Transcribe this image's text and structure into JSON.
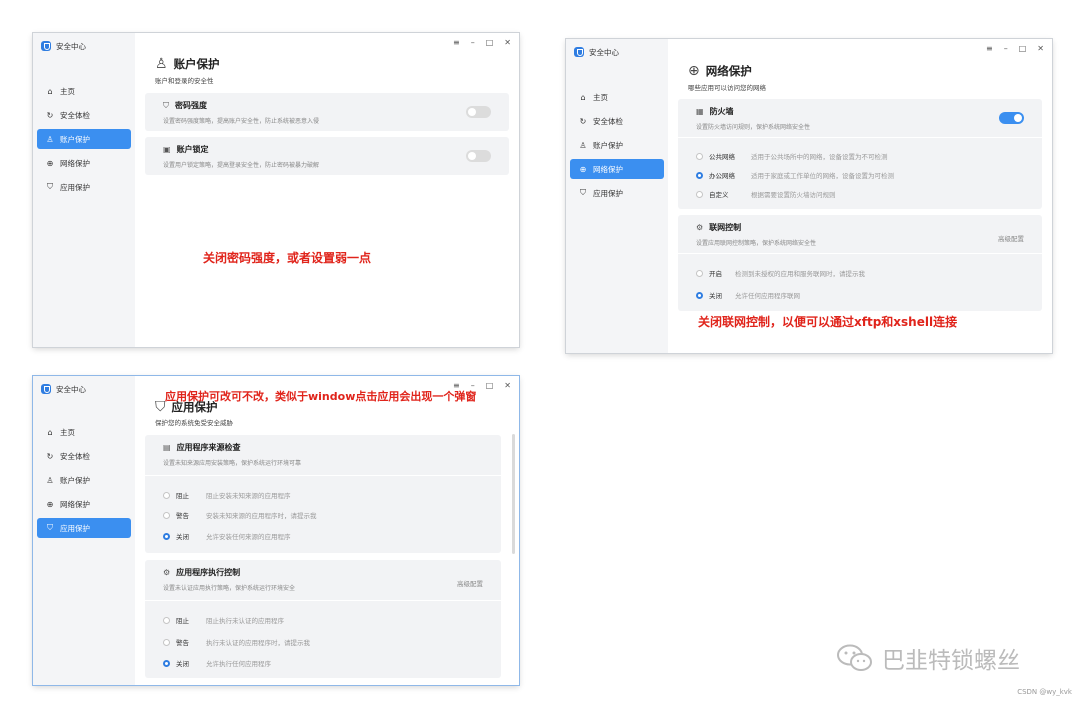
{
  "app_title": "安全中心",
  "nav": [
    "主页",
    "安全体检",
    "账户保护",
    "网络保护",
    "应用保护"
  ],
  "win1": {
    "title": "账户保护",
    "subtitle": "账户和登录的安全性",
    "cards": [
      {
        "title": "密码强度",
        "desc": "设置密码强度策略，提高账户安全性，防止系统被恶意入侵",
        "toggle": false
      },
      {
        "title": "账户锁定",
        "desc": "设置用户锁定策略，提高登录安全性，防止密码被暴力破解",
        "toggle": false
      }
    ],
    "note": "关闭密码强度，或者设置弱一点"
  },
  "win2": {
    "title": "网络保护",
    "subtitle": "哪些应用可以访问您的网络",
    "firewall": {
      "title": "防火墙",
      "desc": "设置防火墙访问规则，保护系统网络安全性",
      "toggle": true,
      "options": [
        {
          "label": "公共网络",
          "desc": "适用于公共场所中的网络，设备设置为不可检测",
          "selected": false
        },
        {
          "label": "办公网络",
          "desc": "适用于家庭或工作单位的网络，设备设置为可检测",
          "selected": true
        },
        {
          "label": "自定义",
          "desc": "根据需要设置防火墙访问规则",
          "selected": false
        }
      ]
    },
    "netctrl": {
      "title": "联网控制",
      "desc": "设置应用联网控制策略，保护系统网络安全性",
      "extra": "高级配置",
      "options": [
        {
          "label": "开启",
          "desc": "检测到未授权的应用和服务联网时，请提示我",
          "selected": false
        },
        {
          "label": "关闭",
          "desc": "允许任何应用程序联网",
          "selected": true
        }
      ]
    },
    "note": "关闭联网控制，以便可以通过xftp和xshell连接"
  },
  "win3": {
    "title": "应用保护",
    "subtitle": "保护您的系统免受安全威胁",
    "source": {
      "title": "应用程序来源检查",
      "desc": "设置未知来源应用安装策略，保护系统运行环境可靠",
      "options": [
        {
          "label": "阻止",
          "desc": "阻止安装未知来源的应用程序",
          "selected": false
        },
        {
          "label": "警告",
          "desc": "安装未知来源的应用程序时，请提示我",
          "selected": false
        },
        {
          "label": "关闭",
          "desc": "允许安装任何来源的应用程序",
          "selected": true
        }
      ]
    },
    "exec": {
      "title": "应用程序执行控制",
      "desc": "设置未认证应用执行策略，保护系统运行环境安全",
      "extra": "高级配置",
      "options": [
        {
          "label": "阻止",
          "desc": "阻止执行未认证的应用程序",
          "selected": false
        },
        {
          "label": "警告",
          "desc": "执行未认证的应用程序时，请提示我",
          "selected": false
        },
        {
          "label": "关闭",
          "desc": "允许执行任何应用程序",
          "selected": true
        }
      ]
    },
    "note": "应用保护可改可不改，类似于window点击应用会出现一个弹窗"
  },
  "watermark": "巴韭特锁螺丝",
  "credit": "CSDN @wy_kvk",
  "colors": {
    "accent": "#3b8ff0",
    "note": "#e0241b"
  }
}
